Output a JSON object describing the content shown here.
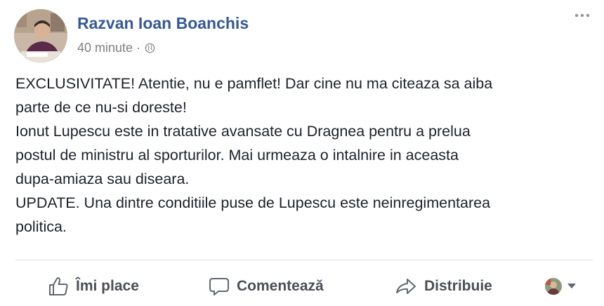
{
  "post": {
    "author": "Razvan Ioan Boanchis",
    "timestamp": "40 minute",
    "separator": "·",
    "privacy_icon": "globe-icon",
    "more_icon": "ellipsis-icon",
    "body_lines": [
      "EXCLUSIVITATE! Atentie, nu e pamflet! Dar cine nu ma citeaza sa aiba",
      "parte de ce nu-si doreste!",
      "Ionut Lupescu este in tratative avansate cu Dragnea pentru a prelua",
      "postul de ministru al sporturilor. Mai urmeaza o intalnire in aceasta",
      "dupa-amiaza sau diseara.",
      "UPDATE. Una dintre conditiile puse de Lupescu este neinregimentarea",
      "politica."
    ]
  },
  "actions": {
    "like_label": "Îmi place",
    "comment_label": "Comentează",
    "share_label": "Distribuie",
    "like_icon": "thumbs-up-icon",
    "comment_icon": "speech-bubble-icon",
    "share_icon": "share-arrow-icon",
    "reactor_icon": "page-avatar-icon",
    "caret_icon": "caret-down-icon"
  },
  "colors": {
    "author": "#365899",
    "meta": "#7f7f7f",
    "text": "#1d2129",
    "action": "#4b4f56",
    "divider": "#dddfe2"
  }
}
